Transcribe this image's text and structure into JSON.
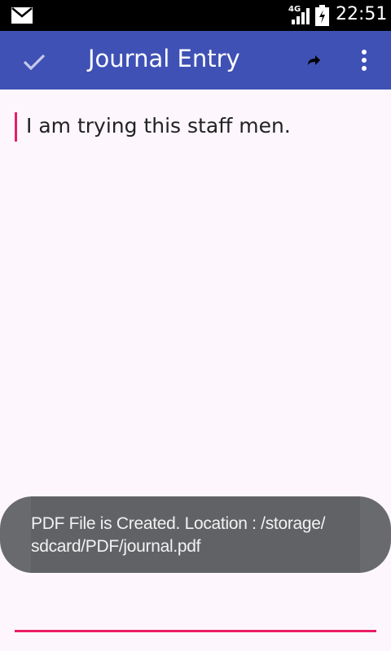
{
  "status_bar": {
    "network": "4G",
    "time": "22:51",
    "icons": [
      "mail-icon",
      "signal-icon",
      "battery-icon"
    ]
  },
  "toolbar": {
    "title": "Journal Entry",
    "background": "#3f51b5",
    "icons": [
      "check-icon",
      "share-icon",
      "more-vert-icon"
    ]
  },
  "editor": {
    "text": "I am trying this staff men.",
    "accent": "#e91e63"
  },
  "toast": {
    "line1": "PDF File is Created. Location : /storage/",
    "line2": "sdcard/PDF/journal.pdf"
  }
}
